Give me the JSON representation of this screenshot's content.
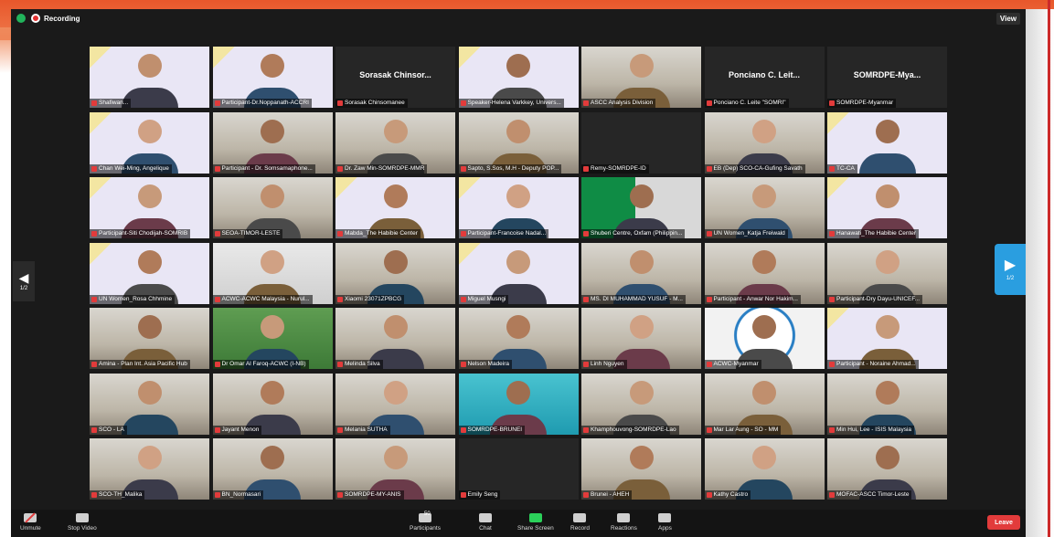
{
  "meeting": {
    "recording_label": "Recording",
    "view_label": "View",
    "page_indicator_left": "1/2",
    "page_indicator_right": "1/2"
  },
  "participants": [
    {
      "name": "Shafiwan...",
      "video": true,
      "style": "banner",
      "active": true
    },
    {
      "name": "Participant-Dr.Noppanath-ACCRI",
      "video": true,
      "style": "banner"
    },
    {
      "name": "Sorasak Chinsomanee",
      "video": false,
      "center_name": "Sorasak Chinsor..."
    },
    {
      "name": "Speaker-Helena Varkkey, Univers...",
      "video": true,
      "style": "banner"
    },
    {
      "name": "ASCC Analysis Division",
      "video": true,
      "style": "office"
    },
    {
      "name": "Ponciano C. Leite \"SOMRI\"",
      "video": false,
      "center_name": "Ponciano C. Leit..."
    },
    {
      "name": "SOMRDPE-Myanmar",
      "video": false,
      "center_name": "SOMRDPE-Mya..."
    },
    {
      "name": "Chan Wei-Ming, Angelique",
      "video": true,
      "style": "banner"
    },
    {
      "name": "Participant - Dr. Somsamaphone...",
      "video": true,
      "style": "office"
    },
    {
      "name": "Dr. Zaw Min-SOMRDPE-MMR",
      "video": true,
      "style": "office"
    },
    {
      "name": "Sapto, S.Sos, M.H - Deputy POP...",
      "video": true,
      "style": "office"
    },
    {
      "name": "Remy-SOMRDPE-ID",
      "video": false,
      "center_name": ""
    },
    {
      "name": "EB (Dep) SCO-CA-Gufing Savath",
      "video": true,
      "style": "office"
    },
    {
      "name": "TC-CA",
      "video": true,
      "style": "banner"
    },
    {
      "name": "Participant-Siti Chodijah-SOMRIB",
      "video": true,
      "style": "banner"
    },
    {
      "name": "SEOA-TIMOR-LESTE",
      "video": true,
      "style": "office"
    },
    {
      "name": "Mabda_The Habibie Center",
      "video": true,
      "style": "banner"
    },
    {
      "name": "Participant-Francoise Nadal...",
      "video": true,
      "style": "banner"
    },
    {
      "name": "Shuberi Centre, Oxfam (Philippin...",
      "video": true,
      "style": "oxfam"
    },
    {
      "name": "UN Women_Katja Freiwald",
      "video": true,
      "style": "office"
    },
    {
      "name": "Hanawati_The Habibie Center",
      "video": true,
      "style": "banner"
    },
    {
      "name": "UN Women_Rosa Chhmine",
      "video": true,
      "style": "banner"
    },
    {
      "name": "ACWC-ACWC Malaysia - Nurul...",
      "video": true,
      "style": "blur"
    },
    {
      "name": "Xiaomi 23071ZPBCG",
      "video": true,
      "style": "office"
    },
    {
      "name": "Miguel Musngi",
      "video": true,
      "style": "banner"
    },
    {
      "name": "MS. DI MUHAMMAD YUSUF - M...",
      "video": true,
      "style": "office"
    },
    {
      "name": "Participant - Anwar Nor Hakim...",
      "video": true,
      "style": "office"
    },
    {
      "name": "Participant-Dry Dayu-UNICEF...",
      "video": true,
      "style": "office"
    },
    {
      "name": "Amina - Plan Int. Asia Pacific Hub",
      "video": true,
      "style": "office"
    },
    {
      "name": "Dr Omar Al Faroq-ACWC (I-NB)",
      "video": true,
      "style": "green"
    },
    {
      "name": "Melinda Silva",
      "video": true,
      "style": "office"
    },
    {
      "name": "Nelson Madeira",
      "video": true,
      "style": "office"
    },
    {
      "name": "Linh Nguyen",
      "video": true,
      "style": "office"
    },
    {
      "name": "ACWC-Myanmar",
      "video": true,
      "style": "logo"
    },
    {
      "name": "Participant - Noraine Ahmad...",
      "video": true,
      "style": "banner"
    },
    {
      "name": "SCO - LA",
      "video": true,
      "style": "office"
    },
    {
      "name": "Jayant Menon",
      "video": true,
      "style": "office"
    },
    {
      "name": "Melania SUTHA",
      "video": true,
      "style": "office"
    },
    {
      "name": "SOMRDPE-BRUNEI",
      "video": true,
      "style": "teal"
    },
    {
      "name": "Khamphouvong-SOMRDPE-Lao",
      "video": true,
      "style": "office"
    },
    {
      "name": "Mar Lar Aung - SO - MM",
      "video": true,
      "style": "office"
    },
    {
      "name": "Min Hui, Lee - ISIS Malaysia",
      "video": true,
      "style": "office"
    },
    {
      "name": "SCO-TH_Malika",
      "video": true,
      "style": "office"
    },
    {
      "name": "BN_Normasari",
      "video": true,
      "style": "office"
    },
    {
      "name": "SOMRDPE-MY-ANIS",
      "video": true,
      "style": "office"
    },
    {
      "name": "Emily Seng",
      "video": false,
      "center_name": ""
    },
    {
      "name": "Brunei - AHEH",
      "video": true,
      "style": "office"
    },
    {
      "name": "Kathy Castro",
      "video": true,
      "style": "office"
    },
    {
      "name": "MOFAC-ASCC Timor-Leste",
      "video": true,
      "style": "office"
    }
  ],
  "toolbar": {
    "unmute": "Unmute",
    "stop_video": "Stop Video",
    "participants": "Participants",
    "participants_count": "50",
    "chat": "Chat",
    "share_screen": "Share Screen",
    "record": "Record",
    "reactions": "Reactions",
    "apps": "Apps",
    "leave": "Leave"
  }
}
